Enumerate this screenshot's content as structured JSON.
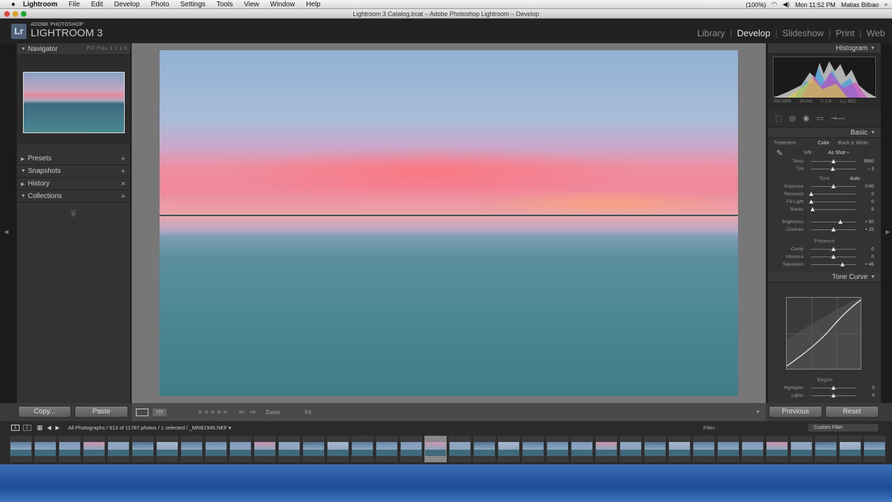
{
  "menubar": {
    "apple": "",
    "items": [
      "Lightroom",
      "File",
      "Edit",
      "Develop",
      "Photo",
      "Settings",
      "Tools",
      "View",
      "Window",
      "Help"
    ],
    "battery": "(100%)",
    "clock": "Mon 11:52 PM",
    "user": "Matias Bilbao"
  },
  "window": {
    "title": "Lightroom 3 Catalog.lrcat – Adobe Photoshop Lightroom – Develop"
  },
  "brand": {
    "logo": "Lr",
    "line1": "ADOBE PHOTOSHOP",
    "line2": "LIGHTROOM 3"
  },
  "modules": [
    "Library",
    "Develop",
    "Slideshow",
    "Print",
    "Web"
  ],
  "active_module": "Develop",
  "left": {
    "navigator": "Navigator",
    "zoom_options": "FIT  FILL  1:1  1:3",
    "panels": [
      {
        "label": "Presets",
        "action": "+"
      },
      {
        "label": "Snapshots",
        "action": "+"
      },
      {
        "label": "History",
        "action": "×"
      },
      {
        "label": "Collections",
        "action": "+"
      }
    ],
    "copy": "Copy...",
    "paste": "Paste"
  },
  "toolbar": {
    "zoom_label": "Zoom",
    "zoom_value": "Fit"
  },
  "right": {
    "histogram": "Histogram",
    "histo_info": [
      "ISO 1600",
      "24 mm",
      "f / 2.8",
      "¹⁄₁₆₀ SEC"
    ],
    "basic": "Basic",
    "treatment_label": "Treatment :",
    "treatment_color": "Color",
    "treatment_bw": "Black & White",
    "wb_label": "WB :",
    "wb_value": "As Shot ÷",
    "tone_label": "Tone",
    "auto": "Auto",
    "presence_label": "Presence",
    "sliders_wb": [
      {
        "label": "Temp",
        "value": "5900",
        "pos": 0.5
      },
      {
        "label": "Tint",
        "value": "– 3",
        "pos": 0.48
      }
    ],
    "sliders_tone": [
      {
        "label": "Exposure",
        "value": "0.00",
        "pos": 0.5
      },
      {
        "label": "Recovery",
        "value": "0",
        "pos": 0.0
      },
      {
        "label": "Fill Light",
        "value": "0",
        "pos": 0.0
      },
      {
        "label": "Blacks",
        "value": "5",
        "pos": 0.03
      }
    ],
    "sliders_bc": [
      {
        "label": "Brightness",
        "value": "+ 50",
        "pos": 0.65
      },
      {
        "label": "Contrast",
        "value": "+ 25",
        "pos": 0.5
      }
    ],
    "sliders_presence": [
      {
        "label": "Clarity",
        "value": "0",
        "pos": 0.5
      },
      {
        "label": "Vibrance",
        "value": "0",
        "pos": 0.5
      },
      {
        "label": "Saturation",
        "value": "+ 45",
        "pos": 0.7
      }
    ],
    "tone_curve": "Tone Curve",
    "region_label": "Region",
    "sliders_region": [
      {
        "label": "Highlights",
        "value": "0",
        "pos": 0.5
      },
      {
        "label": "Lights",
        "value": "0",
        "pos": 0.5
      }
    ],
    "previous": "Previous",
    "reset": "Reset"
  },
  "filmbar": {
    "page1": "1",
    "page2": "2",
    "source": "All Photographs / 913 of 11787 photos / 1 selected / _MRB1945.NEF ▾",
    "filter_label": "Filter :",
    "filter_value": "Custom Filter"
  },
  "colors": {
    "accent": "#e5e5e5",
    "panel": "#333333",
    "desktop": "#2a5aa6"
  }
}
